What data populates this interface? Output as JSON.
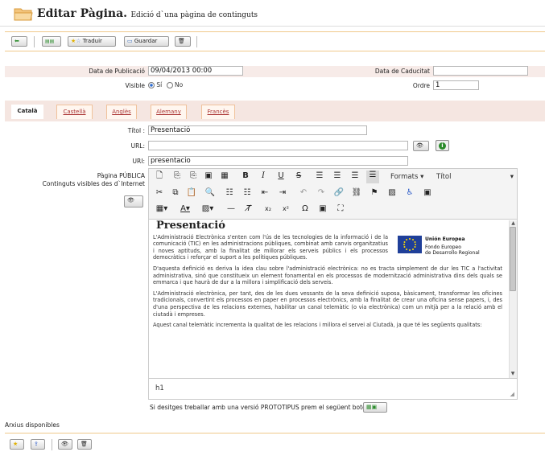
{
  "header": {
    "title": "Editar Pàgina.",
    "subtitle": "Edició d`una pàgina de continguts"
  },
  "toolbar": {
    "translate_label": "Traduir",
    "save_label": "Guardar"
  },
  "form": {
    "pub_date_label": "Data de Publicació",
    "pub_date_value": "09/04/2013 00:00",
    "exp_date_label": "Data de Caducitat",
    "exp_date_value": "",
    "visible_label": "Visible",
    "visible_yes": "Sí",
    "visible_no": "No",
    "order_label": "Ordre",
    "order_value": "1",
    "title_label": "Títol :",
    "title_value": "Presentació",
    "url_label": "URL:",
    "url_value": "",
    "uri_label": "URI:",
    "uri_value": "presentacio",
    "public_page_label": "Pàgina PÚBLICA",
    "public_page_sub": "Continguts visibles des d`Internet"
  },
  "tabs": [
    {
      "label": "Català"
    },
    {
      "label": "Castellà"
    },
    {
      "label": "Anglès"
    },
    {
      "label": "Alemany"
    },
    {
      "label": "Francès"
    }
  ],
  "editor": {
    "formats_label": "Formats",
    "heading_label": "Títol",
    "content_title": "Presentació",
    "p1": "L'Administració Electrònica s'enten com l'ús de les tecnologies de la informació i de la comunicació (TIC) en les administracions públiques, combinat amb canvis organitzatius i noves aptituds, amb la finalitat de millorar els serveis públics i els processos democràtics i reforçar el suport a les polítiques públiques.",
    "p2": "D'aquesta definició es deriva la idea clau sobre l'administració electrònica: no es tracta simplement de dur les TIC a l'activitat administrativa, sinó que constitueix un element fonamental en els processos de modernització administrativa dins dels quals se emmarca i que haurà de dur a la millora i simplificació dels serveis.",
    "p3": "L'Administració electrònica, per tant, des de les dues vessants de la seva definició suposa, bàsicament, transformar les oficines tradicionals, convertint els processos en paper en processos electrònics, amb la finalitat de crear una oficina sense papers, i, des d'una perspectiva de les relacions externes, habilitar un canal telemàtic (o via electrònica) com un mitjà per a la relació amb el ciutadà i empreses.",
    "p4": "Aquest canal telemàtic incrementa la qualitat de les relacions i millora el servei al Ciutadà, ja que té les següents qualitats:",
    "eu_line1": "Unión Europea",
    "eu_line2": "Fondo Europeo",
    "eu_line3": "de Desarrollo Regional",
    "status_path": "h1"
  },
  "footer": {
    "prototype_text": "Si desitges treballar amb una versió PROTOTIPUS prem el següent botó:",
    "files_label": "Arxius disponibles"
  }
}
